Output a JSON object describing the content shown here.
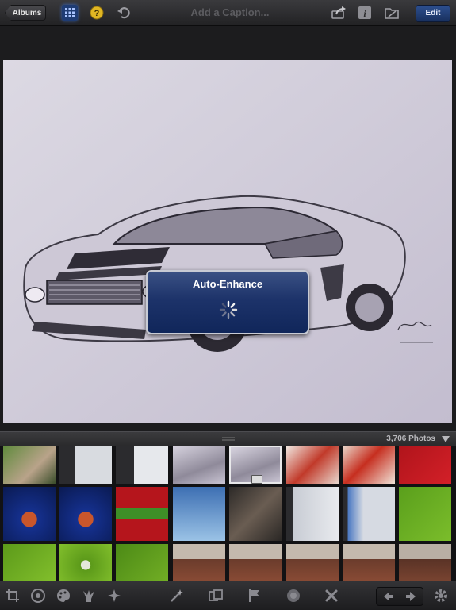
{
  "toolbar": {
    "back_label": "Albums",
    "caption_placeholder": "Add a Caption...",
    "edit_label": "Edit",
    "icons": [
      "grid-icon",
      "help-icon",
      "undo-icon",
      "share-icon",
      "info-icon",
      "folder-icon"
    ]
  },
  "hud": {
    "title": "Auto-Enhance"
  },
  "browser": {
    "photo_count": "3,706 Photos"
  },
  "bottom_toolbar": {
    "icons": [
      "crop-icon",
      "exposure-icon",
      "color-icon",
      "brushes-icon",
      "effects-icon",
      "magic-wand-icon",
      "compare-icon",
      "flag-icon",
      "favorite-icon",
      "reject-icon",
      "previous-icon",
      "next-icon",
      "settings-icon"
    ]
  },
  "colors": {
    "accent": "#1f3c73",
    "hud_blue": "#1d336a",
    "toolbar": "#2a2a2c"
  }
}
